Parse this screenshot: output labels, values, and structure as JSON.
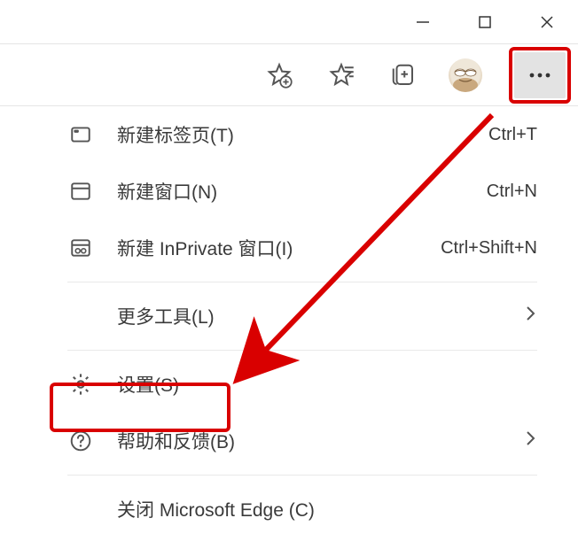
{
  "titlebar": {
    "minimize": "minimize",
    "maximize": "maximize",
    "close": "close"
  },
  "toolbar": {
    "add_favorite": "add-favorite",
    "favorites": "favorites",
    "collections": "collections",
    "profile": "profile",
    "more": "more"
  },
  "menu": {
    "new_tab": {
      "label": "新建标签页(T)",
      "shortcut": "Ctrl+T"
    },
    "new_window": {
      "label": "新建窗口(N)",
      "shortcut": "Ctrl+N"
    },
    "new_inprivate": {
      "label": "新建 InPrivate 窗口(I)",
      "shortcut": "Ctrl+Shift+N"
    },
    "more_tools": {
      "label": "更多工具(L)"
    },
    "settings": {
      "label": "设置(S)"
    },
    "help": {
      "label": "帮助和反馈(B)"
    },
    "close_edge": {
      "label": "关闭 Microsoft Edge (C)"
    }
  }
}
